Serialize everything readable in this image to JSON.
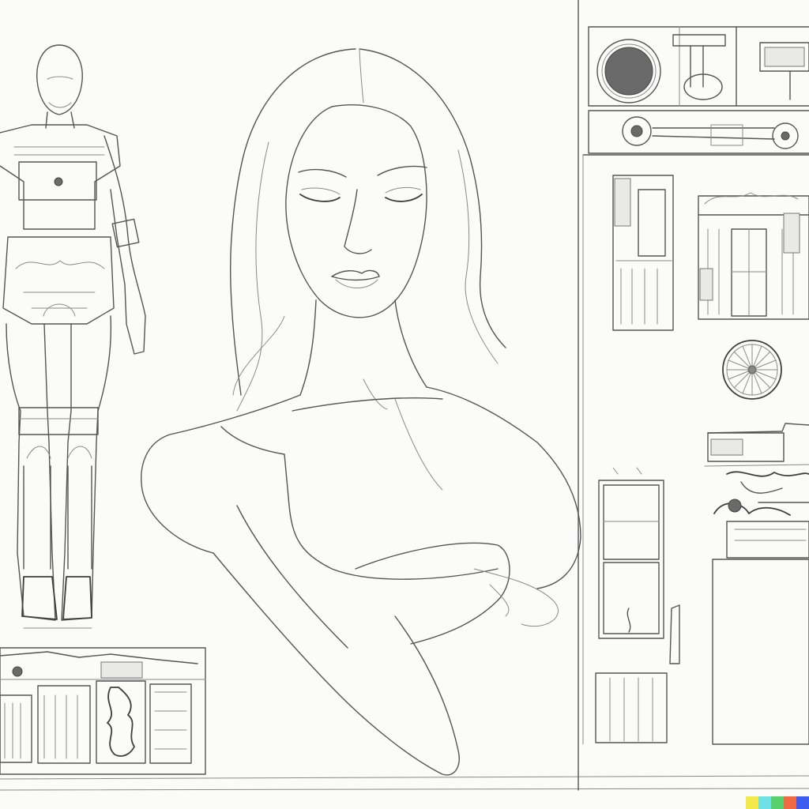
{
  "colors": {
    "paper": "#fbfbfa",
    "ink": "#555555",
    "swatch": [
      "#f5e94a",
      "#6fe0e6",
      "#58d06c",
      "#f06b42",
      "#3d5cf0"
    ]
  },
  "panels": {
    "mannequin": "figure-sketch",
    "portrait": "woman-portrait-sketch",
    "blueprints": "machine-part-sketches",
    "buildings": "building-facade-sketches"
  }
}
